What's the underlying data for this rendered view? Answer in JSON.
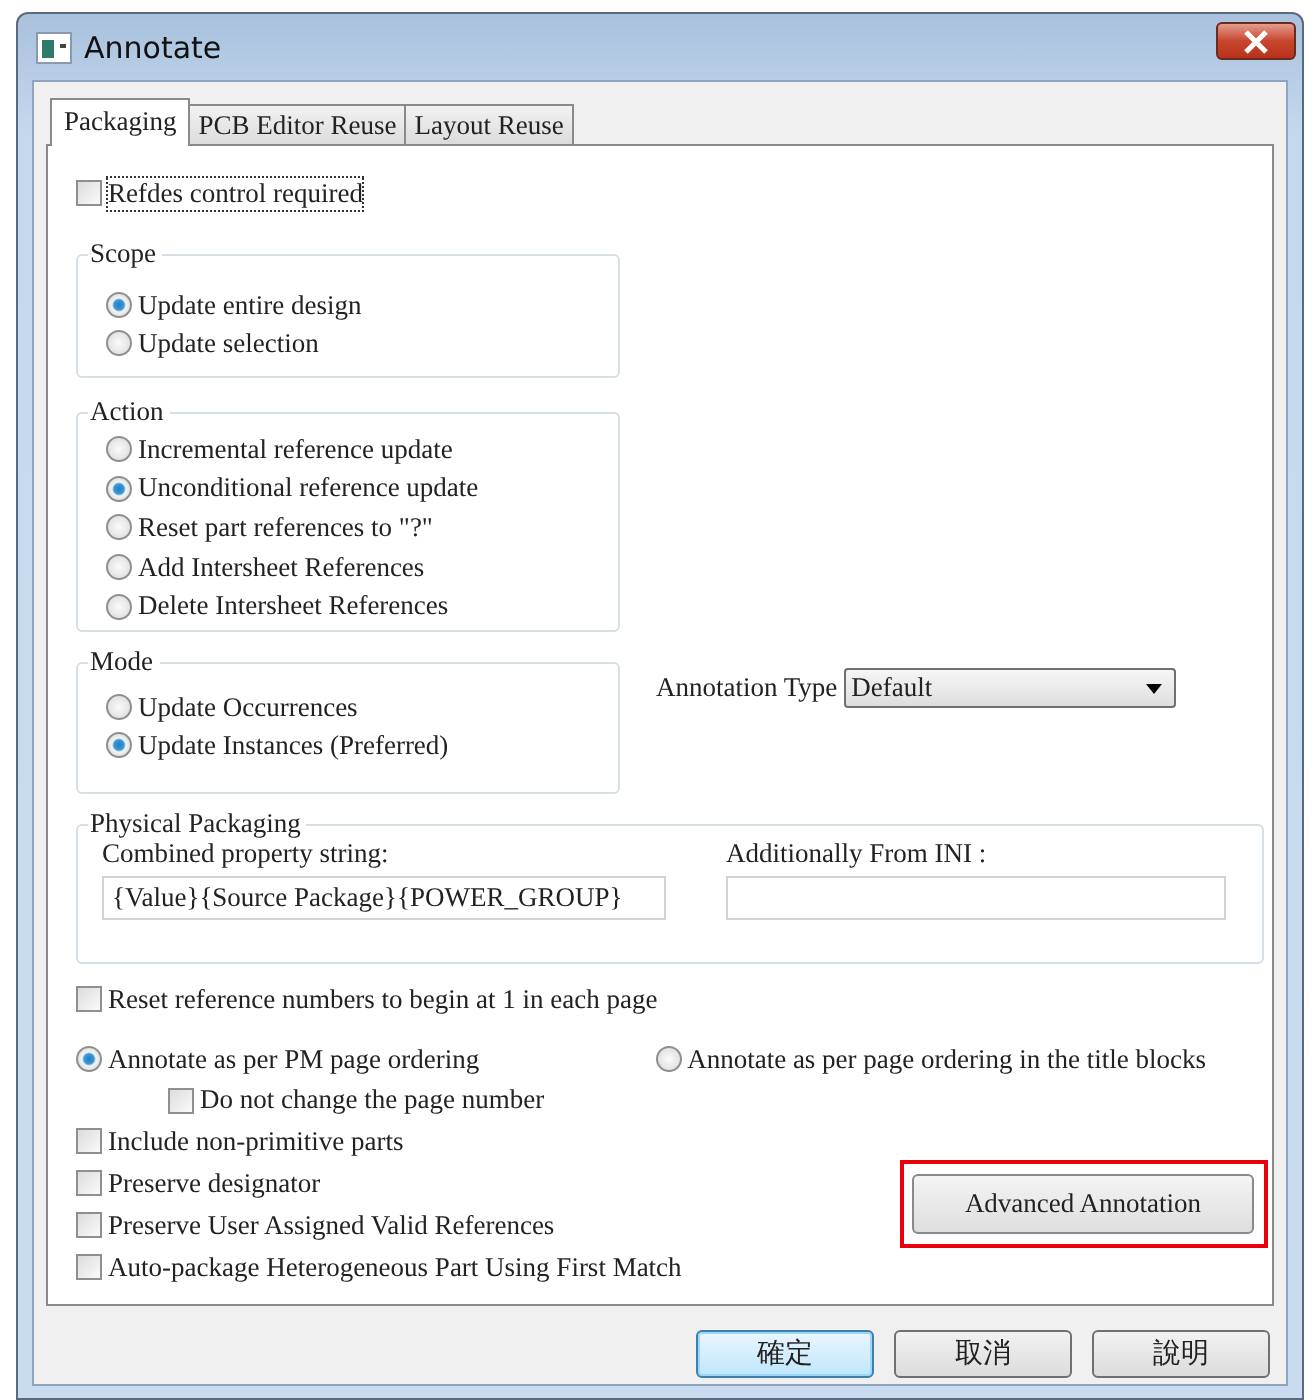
{
  "window": {
    "title": "Annotate"
  },
  "tabs": [
    {
      "label": "Packaging",
      "selected": true
    },
    {
      "label": "PCB Editor Reuse",
      "selected": false
    },
    {
      "label": "Layout Reuse",
      "selected": false
    }
  ],
  "refdes_control": {
    "label": "Refdes control required",
    "checked": false,
    "focused": true
  },
  "scope": {
    "title": "Scope",
    "options": [
      {
        "label": "Update entire design",
        "selected": true
      },
      {
        "label": "Update selection",
        "selected": false
      }
    ]
  },
  "action": {
    "title": "Action",
    "options": [
      {
        "label": "Incremental reference update",
        "selected": false
      },
      {
        "label": "Unconditional reference update",
        "selected": true
      },
      {
        "label": "Reset part references to \"?\"",
        "selected": false
      },
      {
        "label": "Add Intersheet References",
        "selected": false
      },
      {
        "label": "Delete Intersheet References",
        "selected": false
      }
    ]
  },
  "mode": {
    "title": "Mode",
    "options": [
      {
        "label": "Update Occurrences",
        "selected": false
      },
      {
        "label": "Update Instances (Preferred)",
        "selected": true
      }
    ]
  },
  "annotation_type": {
    "label": "Annotation Type",
    "value": "Default"
  },
  "physical_packaging": {
    "title": "Physical Packaging",
    "combined_label": "Combined property string:",
    "combined_value": "{Value}{Source Package}{POWER_GROUP}",
    "ini_label": "Additionally From INI :"
  },
  "reset_numbers": {
    "label": "Reset reference numbers to begin at 1 in each page",
    "checked": false
  },
  "ordering": [
    {
      "label": "Annotate as per PM page ordering",
      "selected": true
    },
    {
      "label": "Annotate as per page ordering in the title blocks",
      "selected": false
    }
  ],
  "keep_page_number": {
    "label": "Do not change the page number",
    "checked": false
  },
  "options": [
    {
      "label": "Include non-primitive parts",
      "checked": false
    },
    {
      "label": "Preserve designator",
      "checked": false
    },
    {
      "label": "Preserve User Assigned Valid References",
      "checked": false
    },
    {
      "label": "Auto-package Heterogeneous Part Using First Match",
      "checked": false
    }
  ],
  "advanced_button": {
    "label": "Advanced Annotation",
    "highlighted": true
  },
  "buttons": [
    {
      "label": "確定",
      "default": true
    },
    {
      "label": "取消",
      "default": false
    },
    {
      "label": "說明",
      "default": false
    }
  ]
}
